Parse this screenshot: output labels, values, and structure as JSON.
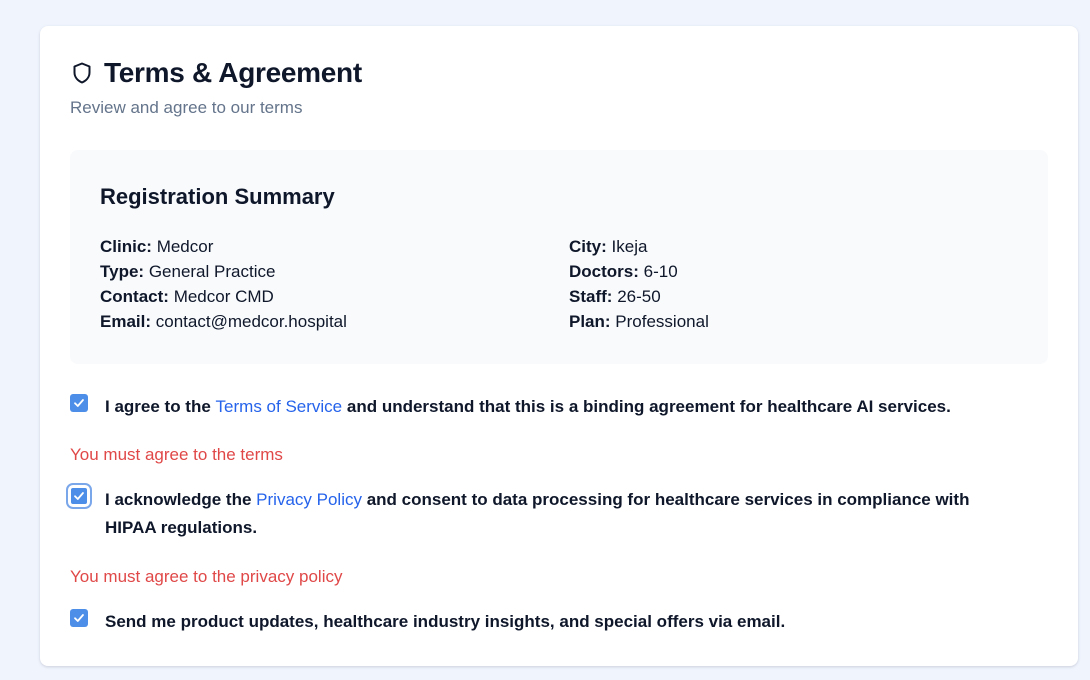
{
  "header": {
    "title": "Terms & Agreement",
    "subtitle": "Review and agree to our terms",
    "icon": "shield-icon"
  },
  "summary": {
    "title": "Registration Summary",
    "left": [
      {
        "label": "Clinic:",
        "value": "Medcor"
      },
      {
        "label": "Type:",
        "value": "General Practice"
      },
      {
        "label": "Contact:",
        "value": "Medcor CMD"
      },
      {
        "label": "Email:",
        "value": "contact@medcor.hospital"
      }
    ],
    "right": [
      {
        "label": "City:",
        "value": "Ikeja"
      },
      {
        "label": "Doctors:",
        "value": "6-10"
      },
      {
        "label": "Staff:",
        "value": "26-50"
      },
      {
        "label": "Plan:",
        "value": "Professional"
      }
    ]
  },
  "terms": {
    "checked": true,
    "prefix": "I agree to the",
    "link": "Terms of Service",
    "suffix": "and understand that this is a binding agreement for healthcare AI services.",
    "error": "You must agree to the terms"
  },
  "privacy": {
    "checked": true,
    "prefix": "I acknowledge the",
    "link": "Privacy Policy",
    "suffix": "and consent to data processing for healthcare services in compliance with HIPAA regulations.",
    "error": "You must agree to the privacy policy"
  },
  "marketing": {
    "checked": true,
    "text": "Send me product updates, healthcare industry insights, and special offers via email."
  },
  "colors": {
    "accent": "#4d8ee8",
    "link": "#2563eb",
    "error": "#e04848",
    "muted": "#64748b",
    "page_bg": "#eff4fd"
  }
}
